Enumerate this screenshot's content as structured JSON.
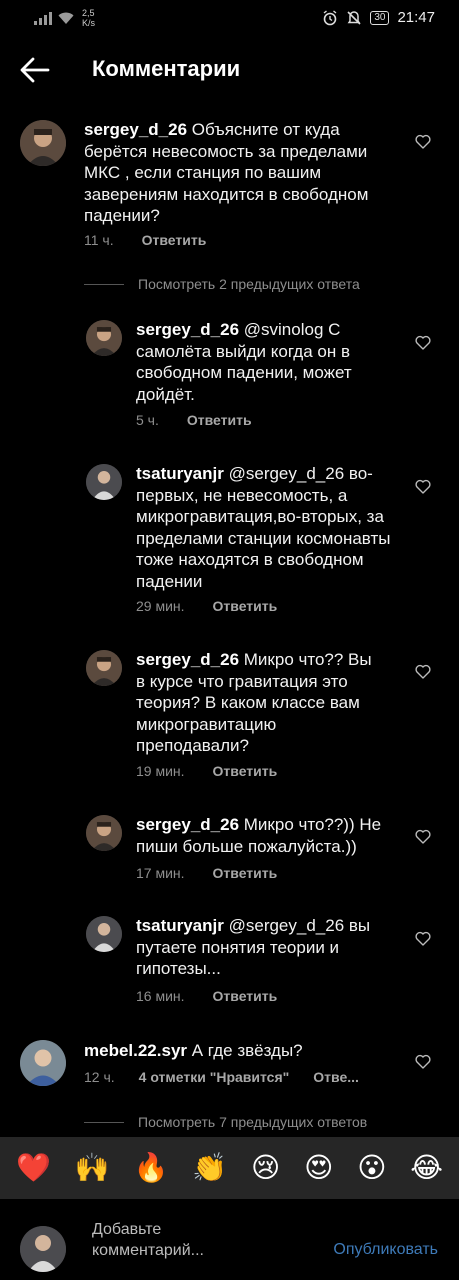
{
  "status_bar": {
    "speed_value": "2,5",
    "speed_unit": "K/s",
    "battery": "30",
    "time": "21:47"
  },
  "header": {
    "title": "Комментарии"
  },
  "comments": [
    {
      "username": "sergey_d_26",
      "text": "Объясните от куда берётся невесомость за пределами МКС , если станция по вашим заверениям находится в свободном падении?",
      "time": "11 ч.",
      "reply_label": "Ответить"
    },
    {
      "username": "sergey_d_26",
      "text": "@svinolog С самолёта выйди когда он в свободном падении, может дойдёт.",
      "time": "5 ч.",
      "reply_label": "Ответить"
    },
    {
      "username": "tsaturyanjr",
      "text": "@sergey_d_26 во-первых, не невесомость, а микрогравитация,во-вторых, за пределами станции космонавты тоже находятся в свободном падении",
      "time": "29 мин.",
      "reply_label": "Ответить"
    },
    {
      "username": "sergey_d_26",
      "text": "Микро что?? Вы в курсе что гравитация это теория? В каком классе вам микрогравитацию преподавали?",
      "time": "19 мин.",
      "reply_label": "Ответить"
    },
    {
      "username": "sergey_d_26",
      "text": "Микро что??)) Не пиши больше пожалуйста.))",
      "time": "17 мин.",
      "reply_label": "Ответить"
    },
    {
      "username": "tsaturyanjr",
      "text": "@sergey_d_26 вы путаете понятия теории и гипотезы...",
      "time": "16 мин.",
      "reply_label": "Ответить"
    },
    {
      "username": "mebel.22.syr",
      "text": "А где звёзды?",
      "time": "12 ч.",
      "likes": "4 отметки \"Нравится\"",
      "reply_label": "Отве..."
    }
  ],
  "view_previous_1": "Посмотреть 2 предыдущих ответа",
  "view_previous_2": "Посмотреть 7 предыдущих ответов",
  "emoji_bar": [
    "❤️",
    "🙌",
    "🔥",
    "👏",
    "😢",
    "😍",
    "😮",
    "😂"
  ],
  "composer": {
    "placeholder": "Добавьте комментарий...",
    "publish_label": "Опубликовать"
  },
  "colors": {
    "background": "#000000",
    "emoji_bar_bg": "#262626",
    "publish_link": "#3e7ab8",
    "heart_red": "#e02b2b"
  },
  "icons": [
    "back-arrow-icon",
    "heart-outline-icon",
    "signal-icon",
    "wifi-icon",
    "alarm-icon",
    "mute-icon",
    "battery-icon"
  ]
}
